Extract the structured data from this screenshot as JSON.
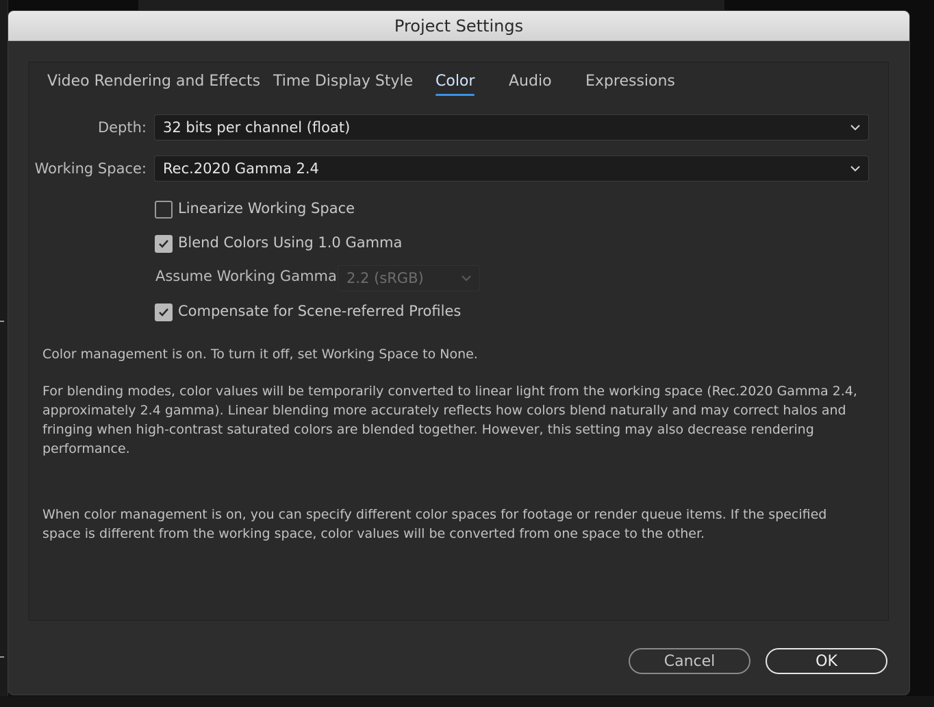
{
  "dialog": {
    "title": "Project Settings"
  },
  "tabs": [
    {
      "label": "Video Rendering and Effects"
    },
    {
      "label": "Time Display Style"
    },
    {
      "label": "Color",
      "active": true
    },
    {
      "label": "Audio"
    },
    {
      "label": "Expressions"
    }
  ],
  "depth": {
    "label": "Depth:",
    "value": "32 bits per channel (float)"
  },
  "working_space": {
    "label": "Working Space:",
    "value": "Rec.2020 Gamma 2.4"
  },
  "options": {
    "linearize": {
      "label": "Linearize Working Space",
      "checked": false
    },
    "blend": {
      "label": "Blend Colors Using 1.0 Gamma",
      "checked": true
    },
    "compensate": {
      "label": "Compensate for Scene-referred Profiles",
      "checked": true
    }
  },
  "gamma": {
    "label": "Assume Working Gamma:",
    "value": "2.2 (sRGB)",
    "disabled": true
  },
  "info": {
    "status": "Color management is on. To turn it off, set Working Space to None.",
    "blending": "For blending modes, color values will be temporarily converted to linear light from the working space (Rec.2020 Gamma 2.4, approximately 2.4 gamma). Linear blending more accurately reflects how colors blend naturally and may correct halos and fringing when high-contrast saturated colors are blended together. However, this setting may also decrease rendering performance.",
    "spaces": "When color management is on, you can specify different color spaces for footage or render queue items. If the specified space is different from the working space, color values will be converted from one space to the other."
  },
  "buttons": {
    "cancel": "Cancel",
    "ok": "OK"
  },
  "colors": {
    "accent": "#3a92e6",
    "background_bars": [
      "#ff0000",
      "#00d000",
      "#0022ee"
    ]
  }
}
